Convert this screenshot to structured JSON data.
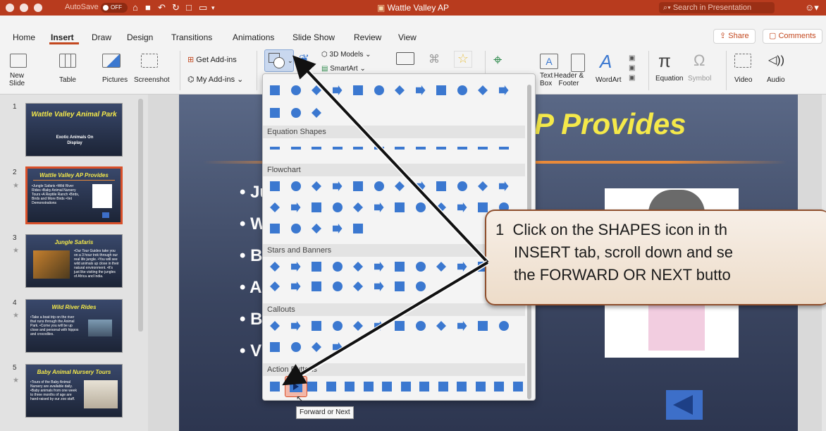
{
  "titlebar": {
    "autosave_label": "AutoSave",
    "autosave_state": "OFF",
    "document_title": "Wattle Valley AP",
    "search_placeholder": "Search in Presentation"
  },
  "tabs": [
    "Home",
    "Insert",
    "Draw",
    "Design",
    "Transitions",
    "Animations",
    "Slide Show",
    "Review",
    "View"
  ],
  "active_tab": "Insert",
  "share_label": "Share",
  "comments_label": "Comments",
  "ribbon": {
    "new_slide": "New\nSlide",
    "table": "Table",
    "pictures": "Pictures",
    "screenshot": "Screenshot",
    "get_addins": "Get Add-ins",
    "my_addins": "My Add-ins",
    "models_3d": "3D Models",
    "smartart": "SmartArt",
    "text_box": "Text\nBox",
    "header_footer": "Header &\nFooter",
    "wordart": "WordArt",
    "equation": "Equation",
    "symbol": "Symbol",
    "video": "Video",
    "audio": "Audio"
  },
  "thumbnails": [
    {
      "num": "1",
      "title": "Wattle Valley Animal Park",
      "subtitle": "Exotic Animals On Display"
    },
    {
      "num": "2",
      "title": "Wattle Valley AP Provides",
      "bullets": "•Jungle Safaris •Wild River Rides •Baby Animal Nursery Tours •A Reptile Ranch •Birds, Birds and More Birds •Vet Demonstrations"
    },
    {
      "num": "3",
      "title": "Jungle Safaris",
      "bullets": "•Our Tour Guides take you on a 3 hour trek through our real life jungle. •You will see wild animals up close in their natural environment. •It's just like visiting the jungles of Africa and India."
    },
    {
      "num": "4",
      "title": "Wild River Rides",
      "bullets": "•Take a boat trip on the river that runs through the Animal Park. •Come you will be up close and personal with hippos and crocodiles."
    },
    {
      "num": "5",
      "title": "Baby Animal Nursery Tours",
      "bullets": "•Tours of the Baby Animal Nursery are available daily. •Baby animals from one week to three months of age are hand-raised by our zoo staff."
    }
  ],
  "slide": {
    "title_fragment": "P Provides",
    "bullet_fragments": [
      "• Ju",
      "• W",
      "• B",
      "• A",
      "• B",
      "• V"
    ]
  },
  "shapes_menu": {
    "sections": [
      "Equation Shapes",
      "Flowchart",
      "Stars and Banners",
      "Callouts",
      "Action Buttons"
    ],
    "tooltip": "Forward or Next",
    "shape_color": "#3b78d0"
  },
  "callout": {
    "step": "1",
    "line1": "Click on the SHAPES icon in th",
    "line2": "INSERT tab, scroll down and se",
    "line3": "the FORWARD OR NEXT butto"
  },
  "colors": {
    "accent": "#c3481f",
    "titlebar": "#b83b1e",
    "slide_title": "#f5e94a"
  }
}
